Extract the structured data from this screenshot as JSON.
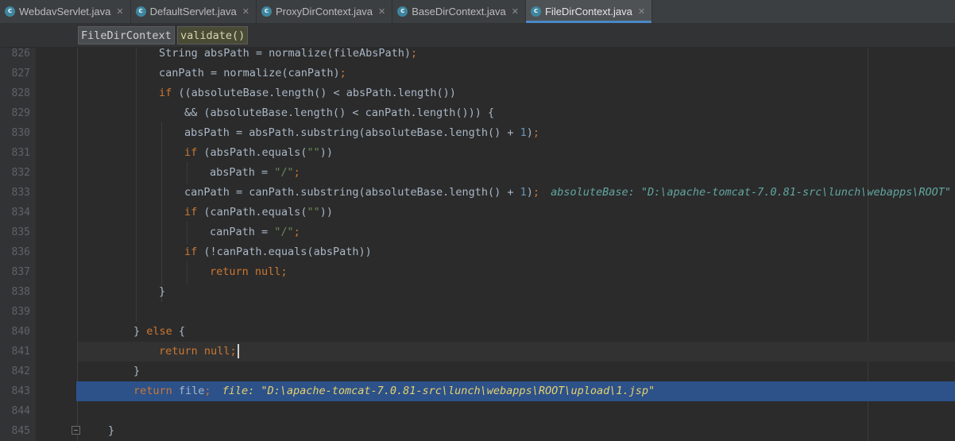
{
  "tabs": [
    {
      "label": "WebdavServlet.java",
      "icon": "java-class-icon",
      "active": false
    },
    {
      "label": "DefaultServlet.java",
      "icon": "java-class-icon",
      "active": false
    },
    {
      "label": "ProxyDirContext.java",
      "icon": "java-class-icon",
      "active": false
    },
    {
      "label": "BaseDirContext.java",
      "icon": "java-class-icon",
      "active": false
    },
    {
      "label": "FileDirContext.java",
      "icon": "java-class-icon",
      "active": true
    }
  ],
  "breadcrumb": {
    "class_name": "FileDirContext",
    "method_name": "validate()"
  },
  "lines": [
    {
      "n": "826",
      "code": "String absPath = normalize(fileAbsPath);"
    },
    {
      "n": "827",
      "code": "canPath = normalize(canPath);"
    },
    {
      "n": "828",
      "code": "if ((absoluteBase.length() < absPath.length())"
    },
    {
      "n": "829",
      "code": "&& (absoluteBase.length() < canPath.length())) {"
    },
    {
      "n": "830",
      "code": "absPath = absPath.substring(absoluteBase.length() + 1);"
    },
    {
      "n": "831",
      "code": "if (absPath.equals(\"\"))"
    },
    {
      "n": "832",
      "code": "absPath = \"/\";"
    },
    {
      "n": "833",
      "code": "canPath = canPath.substring(absoluteBase.length() + 1);",
      "debug": "absoluteBase: \"D:\\apache-tomcat-7.0.81-src\\lunch\\webapps\\ROOT\""
    },
    {
      "n": "834",
      "code": "if (canPath.equals(\"\"))"
    },
    {
      "n": "835",
      "code": "canPath = \"/\";"
    },
    {
      "n": "836",
      "code": "if (!canPath.equals(absPath))"
    },
    {
      "n": "837",
      "code": "return null;"
    },
    {
      "n": "838",
      "code": "}"
    },
    {
      "n": "839",
      "code": ""
    },
    {
      "n": "840",
      "code": "} else {"
    },
    {
      "n": "841",
      "code": "return null;"
    },
    {
      "n": "842",
      "code": "}"
    },
    {
      "n": "843",
      "code": "return file;",
      "debug": "file: \"D:\\apache-tomcat-7.0.81-src\\lunch\\webapps\\ROOT\\upload\\1.jsp\""
    },
    {
      "n": "844",
      "code": ""
    },
    {
      "n": "845",
      "code": "}"
    }
  ]
}
